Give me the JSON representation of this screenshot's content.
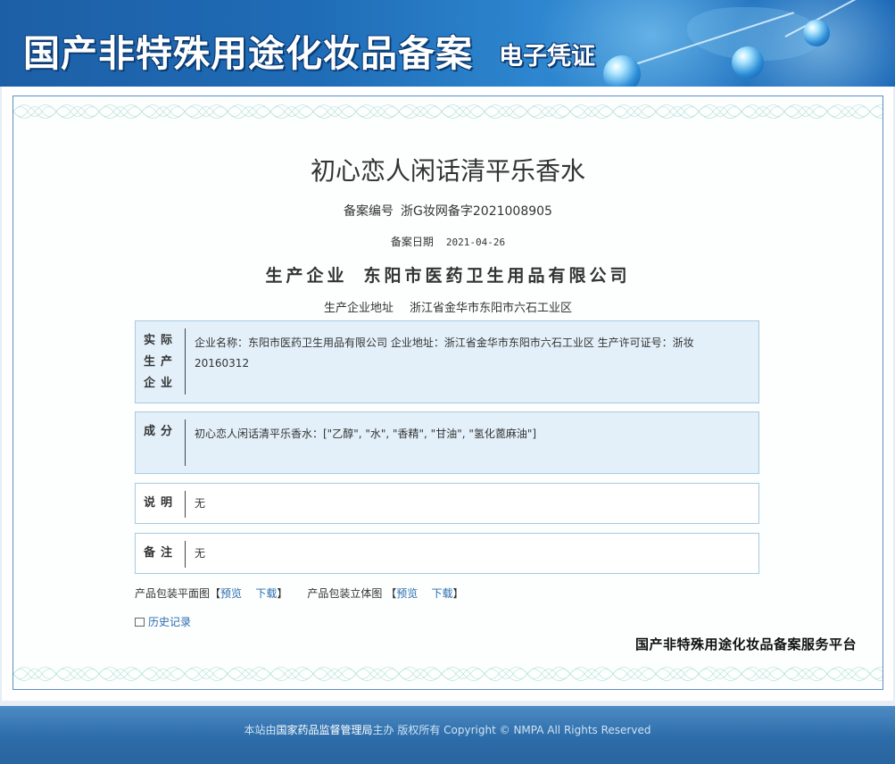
{
  "banner": {
    "title": "国产非特殊用途化妆品备案",
    "subtitle": "电子凭证"
  },
  "certificate": {
    "product_name": "初心恋人闲话清平乐香水",
    "record_number_label": "备案编号",
    "record_number": "浙G妆网备字2021008905",
    "record_date_label": "备案日期",
    "record_date": "2021-04-26",
    "manufacturer_label": "生产企业",
    "manufacturer": "东阳市医药卫生用品有限公司",
    "manufacturer_address_label": "生产企业地址",
    "manufacturer_address": "浙江省金华市东阳市六石工业区",
    "sections": {
      "actual_producer": {
        "label": "实际生产企业",
        "text": "企业名称：东阳市医药卫生用品有限公司 企业地址：浙江省金华市东阳市六石工业区 生产许可证号：浙妆20160312"
      },
      "ingredients": {
        "label": "成分",
        "text": "初心恋人闲话清平乐香水：[\"乙醇\", \"水\", \"香精\", \"甘油\", \"氢化蓖麻油\"]"
      },
      "description": {
        "label": "说明",
        "text": "无"
      },
      "remarks": {
        "label": "备注",
        "text": "无"
      }
    },
    "package_links": {
      "flat_label": "产品包装平面图",
      "flat_preview": "预览",
      "flat_download": "下载",
      "solid_label": "产品包装立体图",
      "solid_preview": "预览",
      "solid_download": "下载",
      "open_bracket": "【",
      "close_bracket": "】"
    },
    "history_link": "历史记录",
    "platform_name": "国产非特殊用途化妆品备案服务平台"
  },
  "footer": {
    "prefix": "本站由",
    "agency": "国家药品监督管理局",
    "suffix": "主办 版权所有 Copyright © NMPA All Rights Reserved"
  }
}
